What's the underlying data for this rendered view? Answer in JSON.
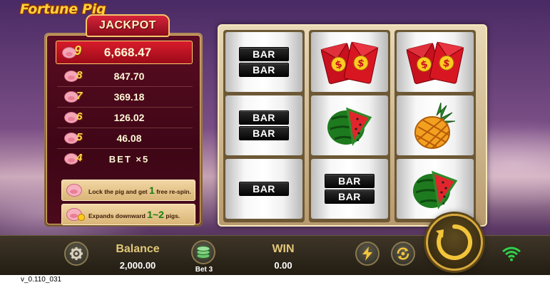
{
  "game": {
    "title": "Fortune Pig"
  },
  "jackpot": {
    "title": "JACKPOT",
    "rows": [
      {
        "level": "9",
        "value": "6,668.47"
      },
      {
        "level": "8",
        "value": "847.70"
      },
      {
        "level": "7",
        "value": "369.18"
      },
      {
        "level": "6",
        "value": "126.02"
      },
      {
        "level": "5",
        "value": "46.08"
      },
      {
        "level": "4",
        "value": "BET ×5"
      }
    ]
  },
  "info": {
    "lock_text": "Lock the pig and get",
    "lock_count": "1",
    "lock_suffix": "free re-spin.",
    "expand_text": "Expands downward",
    "expand_range": "1~2",
    "expand_suffix": "pigs."
  },
  "reels": [
    [
      "bar-double",
      "bar-double",
      "bar-single"
    ],
    [
      "red-envelope",
      "watermelon",
      "bar-double"
    ],
    [
      "red-envelope",
      "pineapple",
      "watermelon"
    ]
  ],
  "symbols": {
    "bar": "BAR"
  },
  "bottom": {
    "balance_label": "Balance",
    "balance_value": "2,000.00",
    "bet_label": "Bet",
    "bet_value": "3",
    "win_label": "WIN",
    "win_value": "0.00"
  },
  "version": "v_0.110_031",
  "colors": {
    "gold": "#d7a83a",
    "label_gold": "#e2c879",
    "jackpot_red": "#d81c2c"
  }
}
